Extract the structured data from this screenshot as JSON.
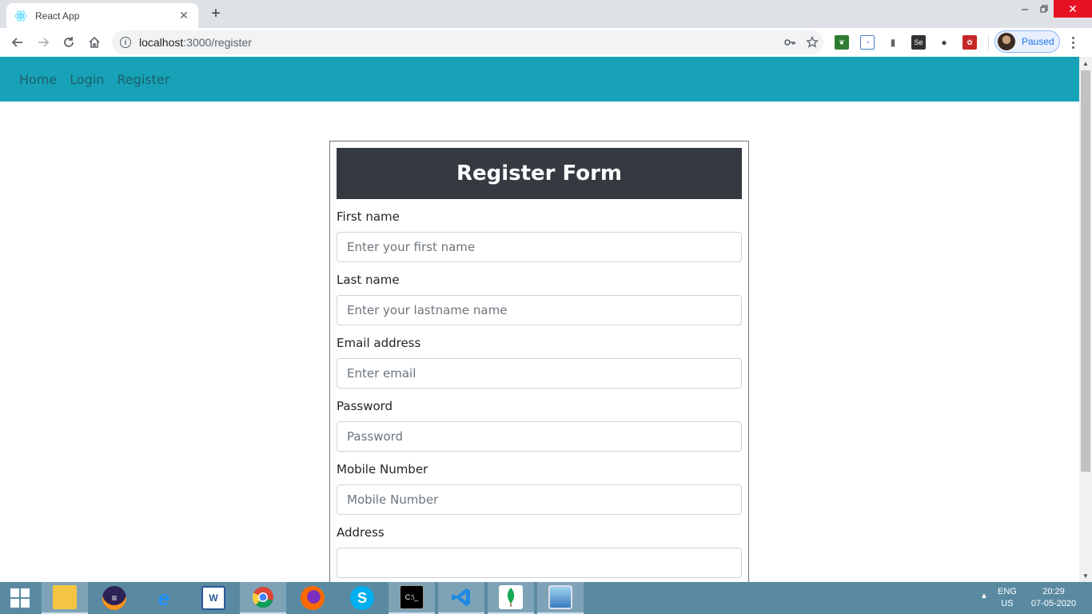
{
  "browser": {
    "tab_title": "React App",
    "url_host": "localhost",
    "url_rest": ":3000/register",
    "profile_status": "Paused"
  },
  "nav": {
    "links": [
      "Home",
      "Login",
      "Register"
    ]
  },
  "form": {
    "title": "Register Form",
    "fields": [
      {
        "label": "First name",
        "placeholder": "Enter your first name"
      },
      {
        "label": "Last name",
        "placeholder": "Enter your lastname name"
      },
      {
        "label": "Email address",
        "placeholder": "Enter email"
      },
      {
        "label": "Password",
        "placeholder": "Password"
      },
      {
        "label": "Mobile Number",
        "placeholder": "Mobile Number"
      },
      {
        "label": "Address",
        "placeholder": ""
      }
    ]
  },
  "taskbar": {
    "apps": [
      "file-explorer",
      "eclipse",
      "internet-explorer",
      "word",
      "chrome",
      "firefox",
      "skype",
      "cmd",
      "vscode",
      "mongodb",
      "photos"
    ],
    "lang_top": "ENG",
    "lang_bottom": "US",
    "time": "20:29",
    "date": "07-05-2020"
  },
  "colors": {
    "navbar": "#17a2b8",
    "form_header": "#343a40",
    "taskbar": "#5a8aa2"
  }
}
